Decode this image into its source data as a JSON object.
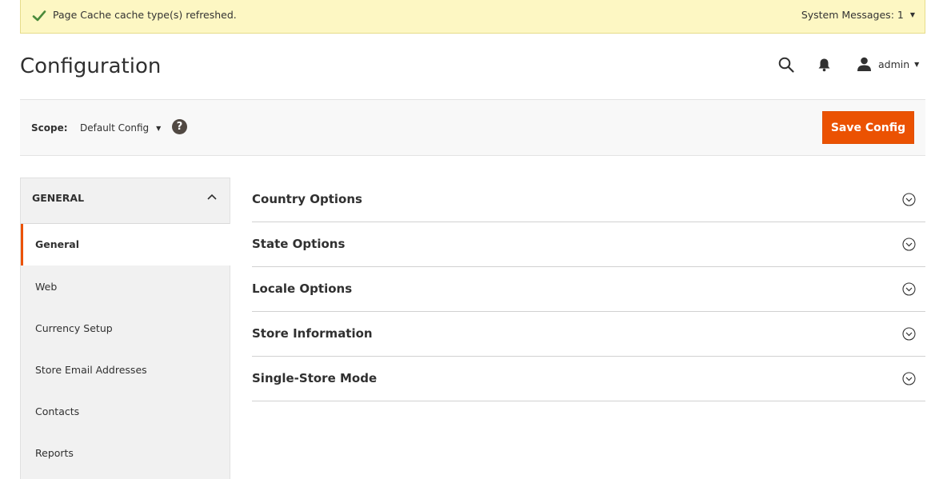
{
  "message": {
    "text": "Page Cache cache type(s) refreshed.",
    "system_messages": "System Messages: 1",
    "icon": "check-icon",
    "color": "#4a8a3a"
  },
  "header": {
    "title": "Configuration",
    "user": "admin"
  },
  "scope": {
    "label": "Scope:",
    "value": "Default Config",
    "help": "?",
    "save_label": "Save Config"
  },
  "sidebar": {
    "group": "GENERAL",
    "items": [
      {
        "label": "General",
        "active": true
      },
      {
        "label": "Web"
      },
      {
        "label": "Currency Setup"
      },
      {
        "label": "Store Email Addresses"
      },
      {
        "label": "Contacts"
      },
      {
        "label": "Reports"
      }
    ]
  },
  "sections": [
    {
      "title": "Country Options"
    },
    {
      "title": "State Options"
    },
    {
      "title": "Locale Options"
    },
    {
      "title": "Store Information"
    },
    {
      "title": "Single-Store Mode"
    }
  ],
  "colors": {
    "accent": "#eb5202",
    "message_bg": "#fdf7c3"
  }
}
